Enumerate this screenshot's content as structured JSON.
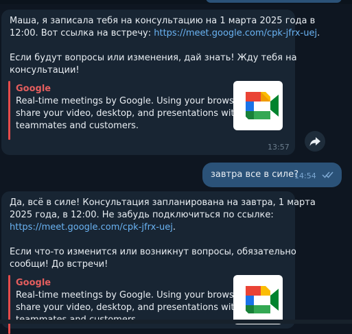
{
  "messages": [
    {
      "direction": "incoming",
      "lines": [
        "Маша, я записала тебя на консультацию на 1 марта 2025 года в",
        "12:00. Вот ссылка на встречу: "
      ],
      "link": "https://meet.google.com/cpk-jfrx-uej",
      "link_suffix": ".",
      "lines2": [
        "Если будут вопросы или изменения, дай знать! Жду тебя на",
        "консультации!"
      ],
      "preview": {
        "site": "Google",
        "desc": [
          "Real-time meetings by Google. Using your browser,",
          "share your video, desktop, and presentations with",
          "teammates and customers."
        ],
        "thumb_icon": "google-meet-logo-icon"
      },
      "time": "13:57"
    },
    {
      "direction": "outgoing",
      "text": "завтра все в силе?",
      "time": "14:54",
      "status_icon": "double-check-icon"
    },
    {
      "direction": "incoming",
      "lines": [
        "Да, всё в силе! Консультация запланирована на завтра, 1 марта",
        "2025 года, в 12:00. Не забудь подключиться по ссылке:"
      ],
      "link": "https://meet.google.com/cpk-jfrx-uej",
      "link_suffix": ".",
      "lines2": [
        "Если что-то изменится или возникнут вопросы, обязательно",
        "сообщи! До встречи!"
      ],
      "preview": {
        "site": "Google",
        "desc": [
          "Real-time meetings by Google. Using your browser,",
          "share your video, desktop, and presentations with",
          "teammates and customers."
        ],
        "thumb_icon": "google-meet-logo-icon"
      }
    }
  ],
  "share_icon": "share-arrow-icon",
  "colors": {
    "background": "#0e1621",
    "incoming_bubble": "#182533",
    "outgoing_bubble": "#2b5278",
    "link": "#6ab3f3",
    "preview_accent": "#e54b4b"
  }
}
